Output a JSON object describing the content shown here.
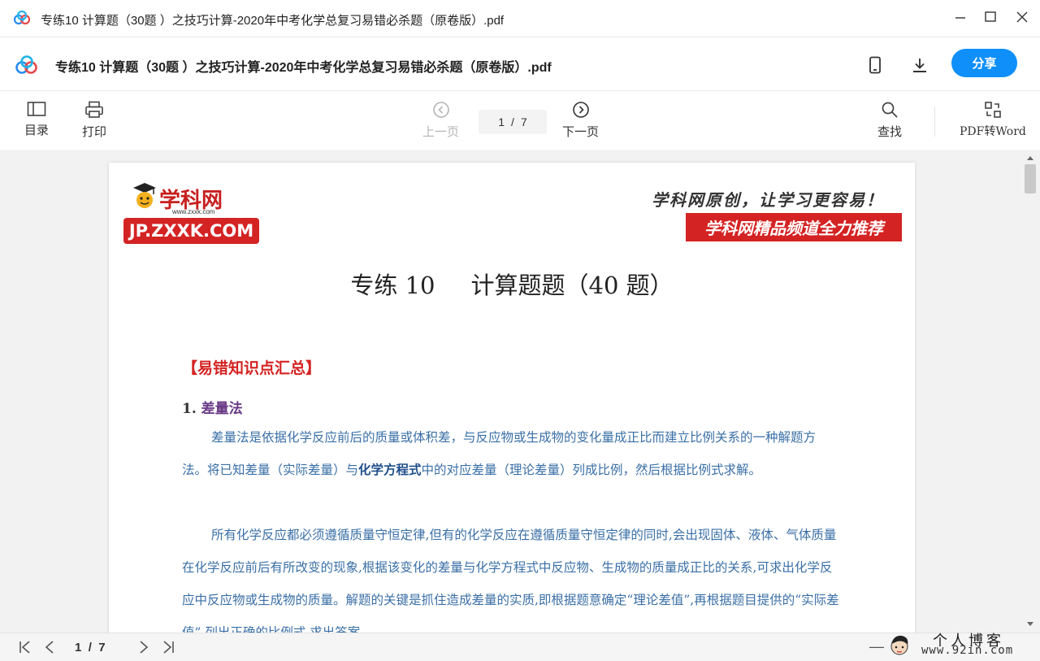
{
  "window": {
    "title": "专练10 计算题（30题 ）之技巧计算-2020年中考化学总复习易错必杀题（原卷版）.pdf"
  },
  "header": {
    "doc_title": "专练10 计算题（30题 ）之技巧计算-2020年中考化学总复习易错必杀题（原卷版）.pdf",
    "share_label": "分享"
  },
  "toolbar": {
    "toc_label": "目录",
    "print_label": "打印",
    "prev_label": "上一页",
    "next_label": "下一页",
    "current_page": "1",
    "page_sep": "/",
    "total_pages": "7",
    "find_label": "查找",
    "pdf2word_label": "PDF转Word"
  },
  "page": {
    "brand_name": "学科网",
    "brand_www": "www.zxxk.com",
    "brand_domain": "JP.ZXXK.COM",
    "slogan": "学科网原创，让学习更容易！",
    "rec_banner": "学科网精品频道全力推荐",
    "heading_left": "专练 10",
    "heading_right": "计算题题（40 题）",
    "section_title": "【易错知识点汇总】",
    "sub_num": "1.",
    "sub_title": "差量法",
    "p1_a": "差量法是依据化学反应前后的质量或体积差，与反应物或生成物的变化量成正比而建立比例关系的一种解题方法。将已知差量（实际差量）与",
    "p1_bold": "化学方程式",
    "p1_b": "中的对应差量（理论差量）列成比例，然后根据比例式求解。",
    "p2": "所有化学反应都必须遵循质量守恒定律,但有的化学反应在遵循质量守恒定律的同时,会出现固体、液体、气体质量在化学反应前后有所改变的现象,根据该变化的差量与化学方程式中反应物、生成物的质量成正比的关系,可求出化学反应中反应物或生成物的质量。解题的关键是抓住造成差量的实质,即根据题意确定“理论差值”,再根据题目提供的“实际差值”,列出正确的比例式,求出答案。"
  },
  "bottombar": {
    "current_page": "1",
    "page_sep": "/",
    "total_pages": "7",
    "zoom_minus": "—"
  },
  "watermark": {
    "line1": "个人博客",
    "line2": "www.92in.com"
  },
  "colors": {
    "accent": "#0f8ffa",
    "red": "#d42323",
    "body_text": "#3a6fa6"
  }
}
